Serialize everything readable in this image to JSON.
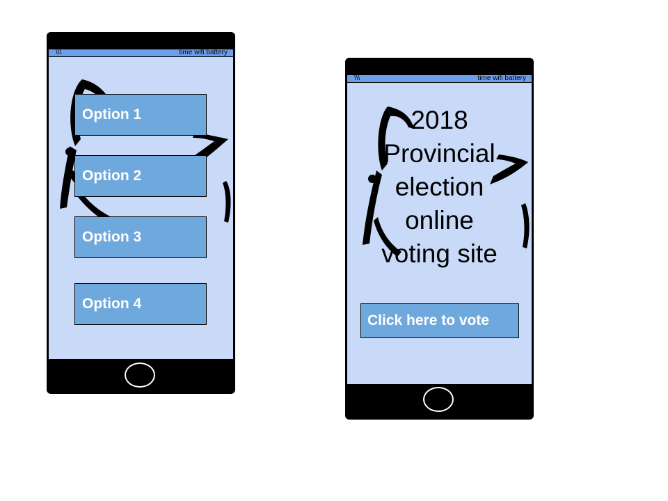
{
  "left_phone": {
    "status_bar": {
      "signal": "\\\\\\",
      "right": "time wifi battery"
    },
    "options": [
      {
        "label": "Option 1"
      },
      {
        "label": "Option 2"
      },
      {
        "label": "Option 3"
      },
      {
        "label": "Option 4"
      }
    ]
  },
  "right_phone": {
    "status_bar": {
      "signal": "\\\\\\",
      "right": "time wifi battery"
    },
    "title_lines": [
      "2018",
      "Provincial",
      "election",
      "online",
      "voting site"
    ],
    "vote_button": "Click here to vote"
  },
  "colors": {
    "screen_bg": "#c9daf8",
    "status_bar": "#6d9eeb",
    "button": "#6fa8dc",
    "phone_body": "#000000"
  },
  "icons": [
    "trillium-logo-icon",
    "home-button-icon"
  ]
}
